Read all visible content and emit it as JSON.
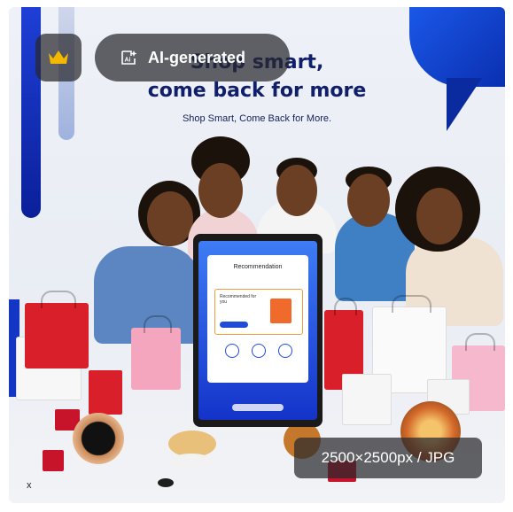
{
  "image": {
    "headline_line1": "Shop smart,",
    "headline_line2": "come back for more",
    "subheadline": "Shop Smart, Come Back for More.",
    "tablet": {
      "card_title": "Recommendation",
      "reco_text": "Recommended for you"
    }
  },
  "overlays": {
    "premium_icon": "crown-icon",
    "ai_label": "AI-generated",
    "ai_icon": "ai-sparkle-icon",
    "dimensions": "2500×2500px / JPG",
    "corner_mark": "x"
  },
  "colors": {
    "brand_blue": "#1433c9",
    "crown_gold": "#f5b800",
    "badge_bg": "rgba(40,40,44,0.72)"
  }
}
